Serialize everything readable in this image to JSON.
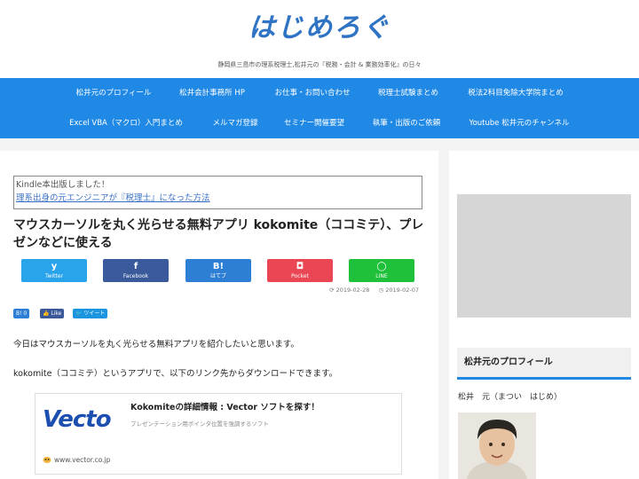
{
  "header": {
    "logo": "はじめろぐ",
    "tagline": "静岡県三島市の理系税理士,松井元の『税務・会計 & 業務効率化』の日々"
  },
  "nav": {
    "row1": [
      "松井元のプロフィール",
      "松井会計事務所 HP",
      "お仕事・お問い合わせ",
      "税理士試験まとめ",
      "税法2科目免除大学院まとめ"
    ],
    "row2": [
      "Excel VBA（マクロ）入門まとめ",
      "メルマガ登録",
      "セミナー開催要望",
      "執筆・出版のご依頼",
      "Youtube 松井元のチャンネル"
    ]
  },
  "kindle": {
    "line1": "Kindle本出版しました！",
    "line2": "理系出身の元エンジニアが『税理士』になった方法"
  },
  "article": {
    "title": "マウスカーソルを丸く光らせる無料アプリ kokomite（ココミテ）、プレゼンなどに使える",
    "date_updated": "2019-02-28",
    "date_published": "2019-02-07",
    "para1": "今日はマウスカーソルを丸く光らせる無料アプリを紹介したいと思います。",
    "para2": "kokomite（ココミテ）というアプリで、以下のリンク先からダウンロードできます。"
  },
  "share": [
    {
      "icon": "y",
      "label": "Twitter",
      "color": "#29a3ea"
    },
    {
      "icon": "f",
      "label": "Facebook",
      "color": "#3a5a9c"
    },
    {
      "icon": "B!",
      "label": "はてブ",
      "color": "#2d7ed5"
    },
    {
      "icon": "◘",
      "label": "Pocket",
      "color": "#ea4654"
    },
    {
      "icon": "◯",
      "label": "LINE",
      "color": "#1fc13a"
    }
  ],
  "mini_buttons": {
    "hatena": "B! 0",
    "like": "👍 Like",
    "tweet": "🐦 ツイート"
  },
  "card": {
    "logo": "Vecto",
    "title": "Kokomiteの詳細情報 : Vector ソフトを探す！",
    "desc": "プレゼンテーション用ポインタ位置を強調するソフト",
    "url": "www.vector.co.jp"
  },
  "sidebar": {
    "widget_title": "松井元のプロフィール",
    "profile_name": "松井　元（まつい　はじめ）"
  }
}
